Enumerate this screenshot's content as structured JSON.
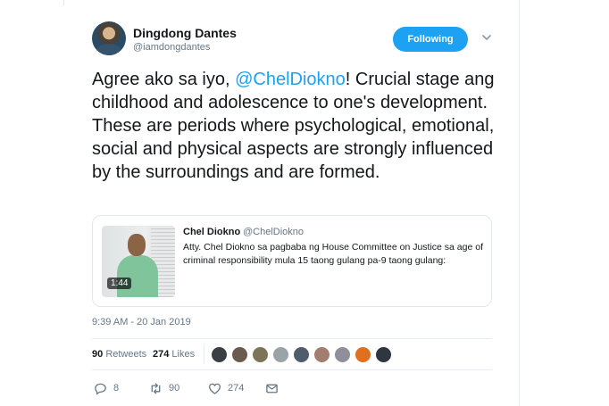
{
  "tweet": {
    "author": {
      "display_name": "Dingdong Dantes",
      "screen_name": "@iamdongdantes",
      "avatar_icon": "profile-photo"
    },
    "follow_button_label": "Following",
    "follow_button_color": "#1da1f2",
    "text_before": "Agree ako sa iyo, ",
    "mention": "@ChelDiokno",
    "text_after": "! Crucial stage ang childhood and adolescence to one's development. These are periods where psychological, emotional, social and physical aspects are strongly influenced by the surroundings and are formed.",
    "quoted": {
      "name": "Chel Diokno",
      "handle": "@ChelDiokno",
      "text": "Atty. Chel Diokno sa pagbaba ng House Committee on Justice sa age of criminal responsibility mula 15 taong gulang pa-9 taong gulang:",
      "video_duration": "1:44"
    },
    "timestamp": "9:39 AM - 20 Jan 2019",
    "retweet_count": "90",
    "retweet_label": "Retweets",
    "like_count": "274",
    "like_label": "Likes",
    "liker_colors": [
      "#3a3f45",
      "#6b5a4e",
      "#7d7359",
      "#9aa3a8",
      "#4f5c6b",
      "#a37d6f",
      "#8e8f9a",
      "#e0701f",
      "#2f3640"
    ],
    "actions": {
      "reply_count": "8",
      "retweet_count": "90",
      "like_count": "274"
    }
  }
}
